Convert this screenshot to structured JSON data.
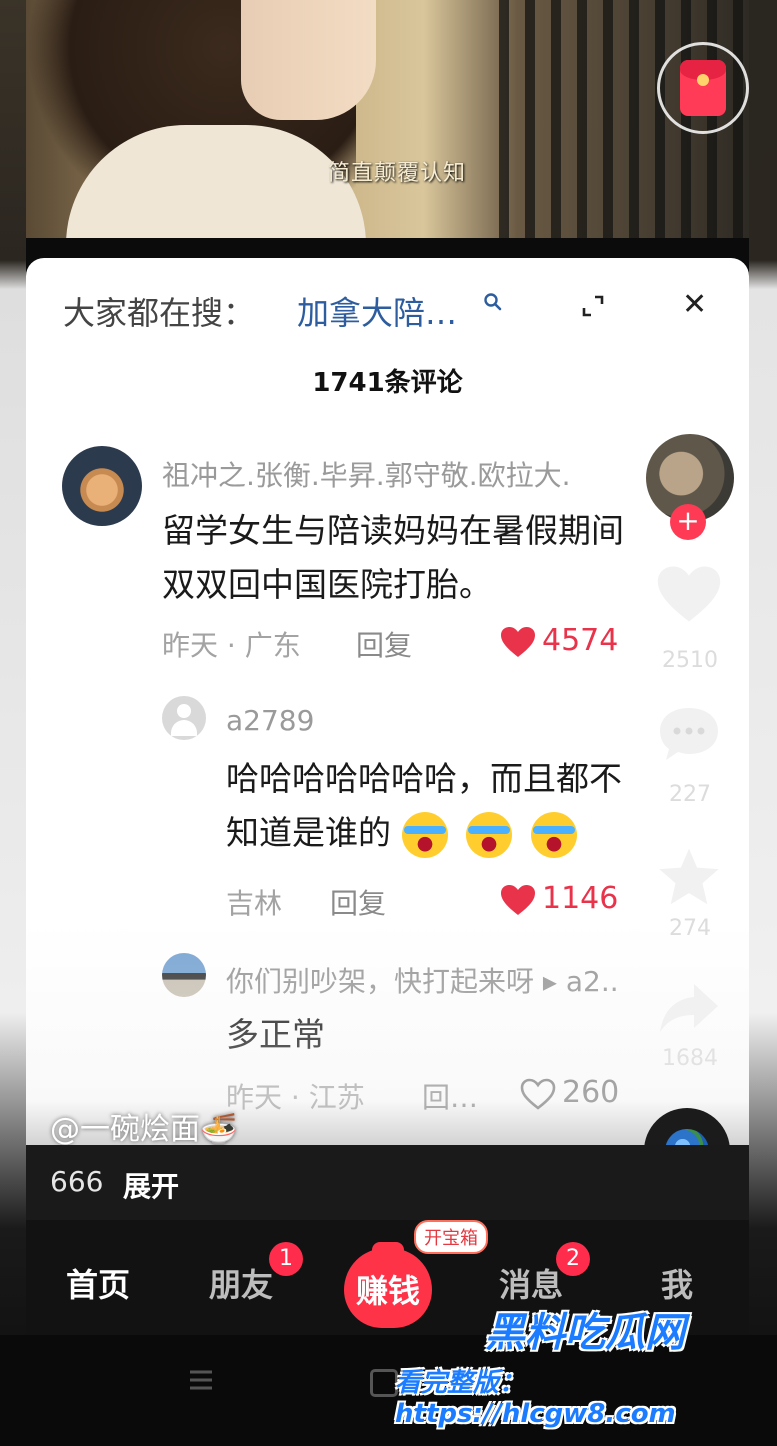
{
  "video": {
    "subtitle": "简直颠覆认知"
  },
  "sheet": {
    "search_prefix": "大家都在搜：",
    "search_term": "加拿大陪…",
    "comment_count": "1741条评论"
  },
  "comments": [
    {
      "username": "祖冲之.张衡.毕昇.郭守敬.欧拉大.",
      "text_line1": "留学女生与陪读妈妈在暑假期间",
      "text_line2": "双双回中国医院打胎。",
      "meta": "昨天 · 广东",
      "reply": "回复",
      "likes": "4574"
    },
    {
      "username": "a2789",
      "text_line1": "哈哈哈哈哈哈哈，而且都不",
      "text_line2": "知道是谁的",
      "meta": "吉林",
      "reply": "回复",
      "likes": "1146"
    },
    {
      "username": "你们别吵架，快打起来呀 ▸ a2..",
      "text_line1": "多正常",
      "meta": "昨天 · 江苏",
      "reply": "回…",
      "likes": "260"
    }
  ],
  "rail": {
    "likes": "2510",
    "comments": "227",
    "favorites": "274",
    "shares": "1684"
  },
  "author": "@一碗烩面🍜",
  "description": {
    "count": "666",
    "expand": "展开"
  },
  "nav": {
    "home": "首页",
    "friends": "朋友",
    "friends_badge": "1",
    "earn": "赚钱",
    "earn_tag": "开宝箱",
    "messages": "消息",
    "messages_badge": "2",
    "me": "我"
  },
  "watermark": {
    "brand": "黑料吃瓜网",
    "link": "看完整版：https://hlcgw8.com"
  },
  "colors": {
    "like_red": "#e8334a",
    "search_blue": "#2d5d9e",
    "earn_red": "#ff3348",
    "watermark_blue": "#1b7cff"
  }
}
